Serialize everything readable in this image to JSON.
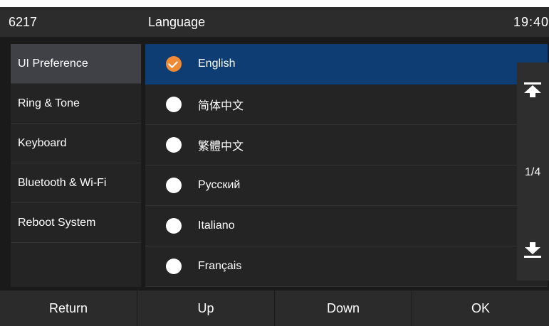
{
  "status_bar": {
    "account": "6217",
    "title": "Language",
    "time": "19:40"
  },
  "sidebar": {
    "items": [
      {
        "label": "UI Preference",
        "active": true
      },
      {
        "label": "Ring & Tone",
        "active": false
      },
      {
        "label": "Keyboard",
        "active": false
      },
      {
        "label": "Bluetooth & Wi-Fi",
        "active": false
      },
      {
        "label": "Reboot System",
        "active": false
      }
    ]
  },
  "languages": {
    "options": [
      {
        "label": "English",
        "selected": true
      },
      {
        "label": "简体中文",
        "selected": false
      },
      {
        "label": "繁體中文",
        "selected": false
      },
      {
        "label": "Русский",
        "selected": false
      },
      {
        "label": "Italiano",
        "selected": false
      },
      {
        "label": "Français",
        "selected": false
      }
    ]
  },
  "scroller": {
    "page_indicator": "1/4",
    "top_icon": "scroll-to-top-icon",
    "bottom_icon": "scroll-to-bottom-icon"
  },
  "softkeys": {
    "return_label": "Return",
    "up_label": "Up",
    "down_label": "Down",
    "ok_label": "OK"
  },
  "colors": {
    "selection": "#0e3d73",
    "checked_radio": "#ef8a35",
    "sidebar_active": "#3f4147"
  }
}
